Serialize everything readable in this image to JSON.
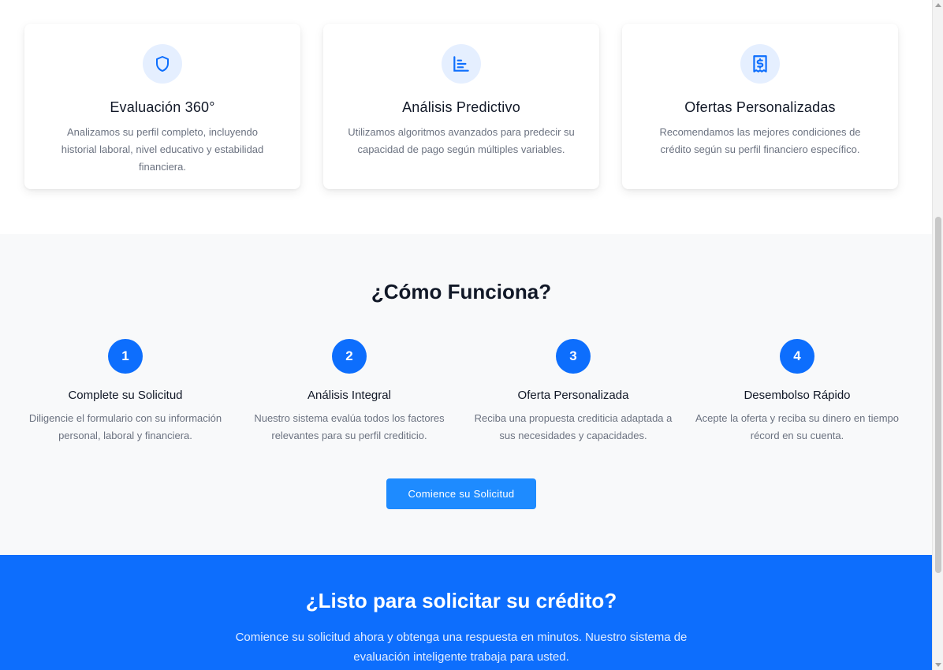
{
  "features": {
    "cards": [
      {
        "icon": "shield-icon",
        "title": "Evaluación 360°",
        "description": "Analizamos su perfil completo, incluyendo historial laboral, nivel educativo y estabilidad financiera."
      },
      {
        "icon": "bar-chart-icon",
        "title": "Análisis Predictivo",
        "description": "Utilizamos algoritmos avanzados para predecir su capacidad de pago según múltiples variables."
      },
      {
        "icon": "dollar-receipt-icon",
        "title": "Ofertas Personalizadas",
        "description": "Recomendamos las mejores condiciones de crédito según su perfil financiero específico."
      }
    ]
  },
  "how_it_works": {
    "heading": "¿Cómo Funciona?",
    "steps": [
      {
        "number": "1",
        "title": "Complete su Solicitud",
        "description": "Diligencie el formulario con su información personal, laboral y financiera."
      },
      {
        "number": "2",
        "title": "Análisis Integral",
        "description": "Nuestro sistema evalúa todos los factores relevantes para su perfil crediticio."
      },
      {
        "number": "3",
        "title": "Oferta Personalizada",
        "description": "Reciba una propuesta crediticia adaptada a sus necesidades y capacidades."
      },
      {
        "number": "4",
        "title": "Desembolso Rápido",
        "description": "Acepte la oferta y reciba su dinero en tiempo récord en su cuenta."
      }
    ],
    "cta_label": "Comience su Solicitud"
  },
  "ready": {
    "heading": "¿Listo para solicitar su crédito?",
    "text": "Comience su solicitud ahora y obtenga una respuesta en minutos. Nuestro sistema de evaluación inteligente trabaja para usted."
  },
  "colors": {
    "primary": "#0d6efd",
    "button": "#1e8bff",
    "icon_bg": "#e5efff",
    "section_bg": "#f8f9fa"
  }
}
